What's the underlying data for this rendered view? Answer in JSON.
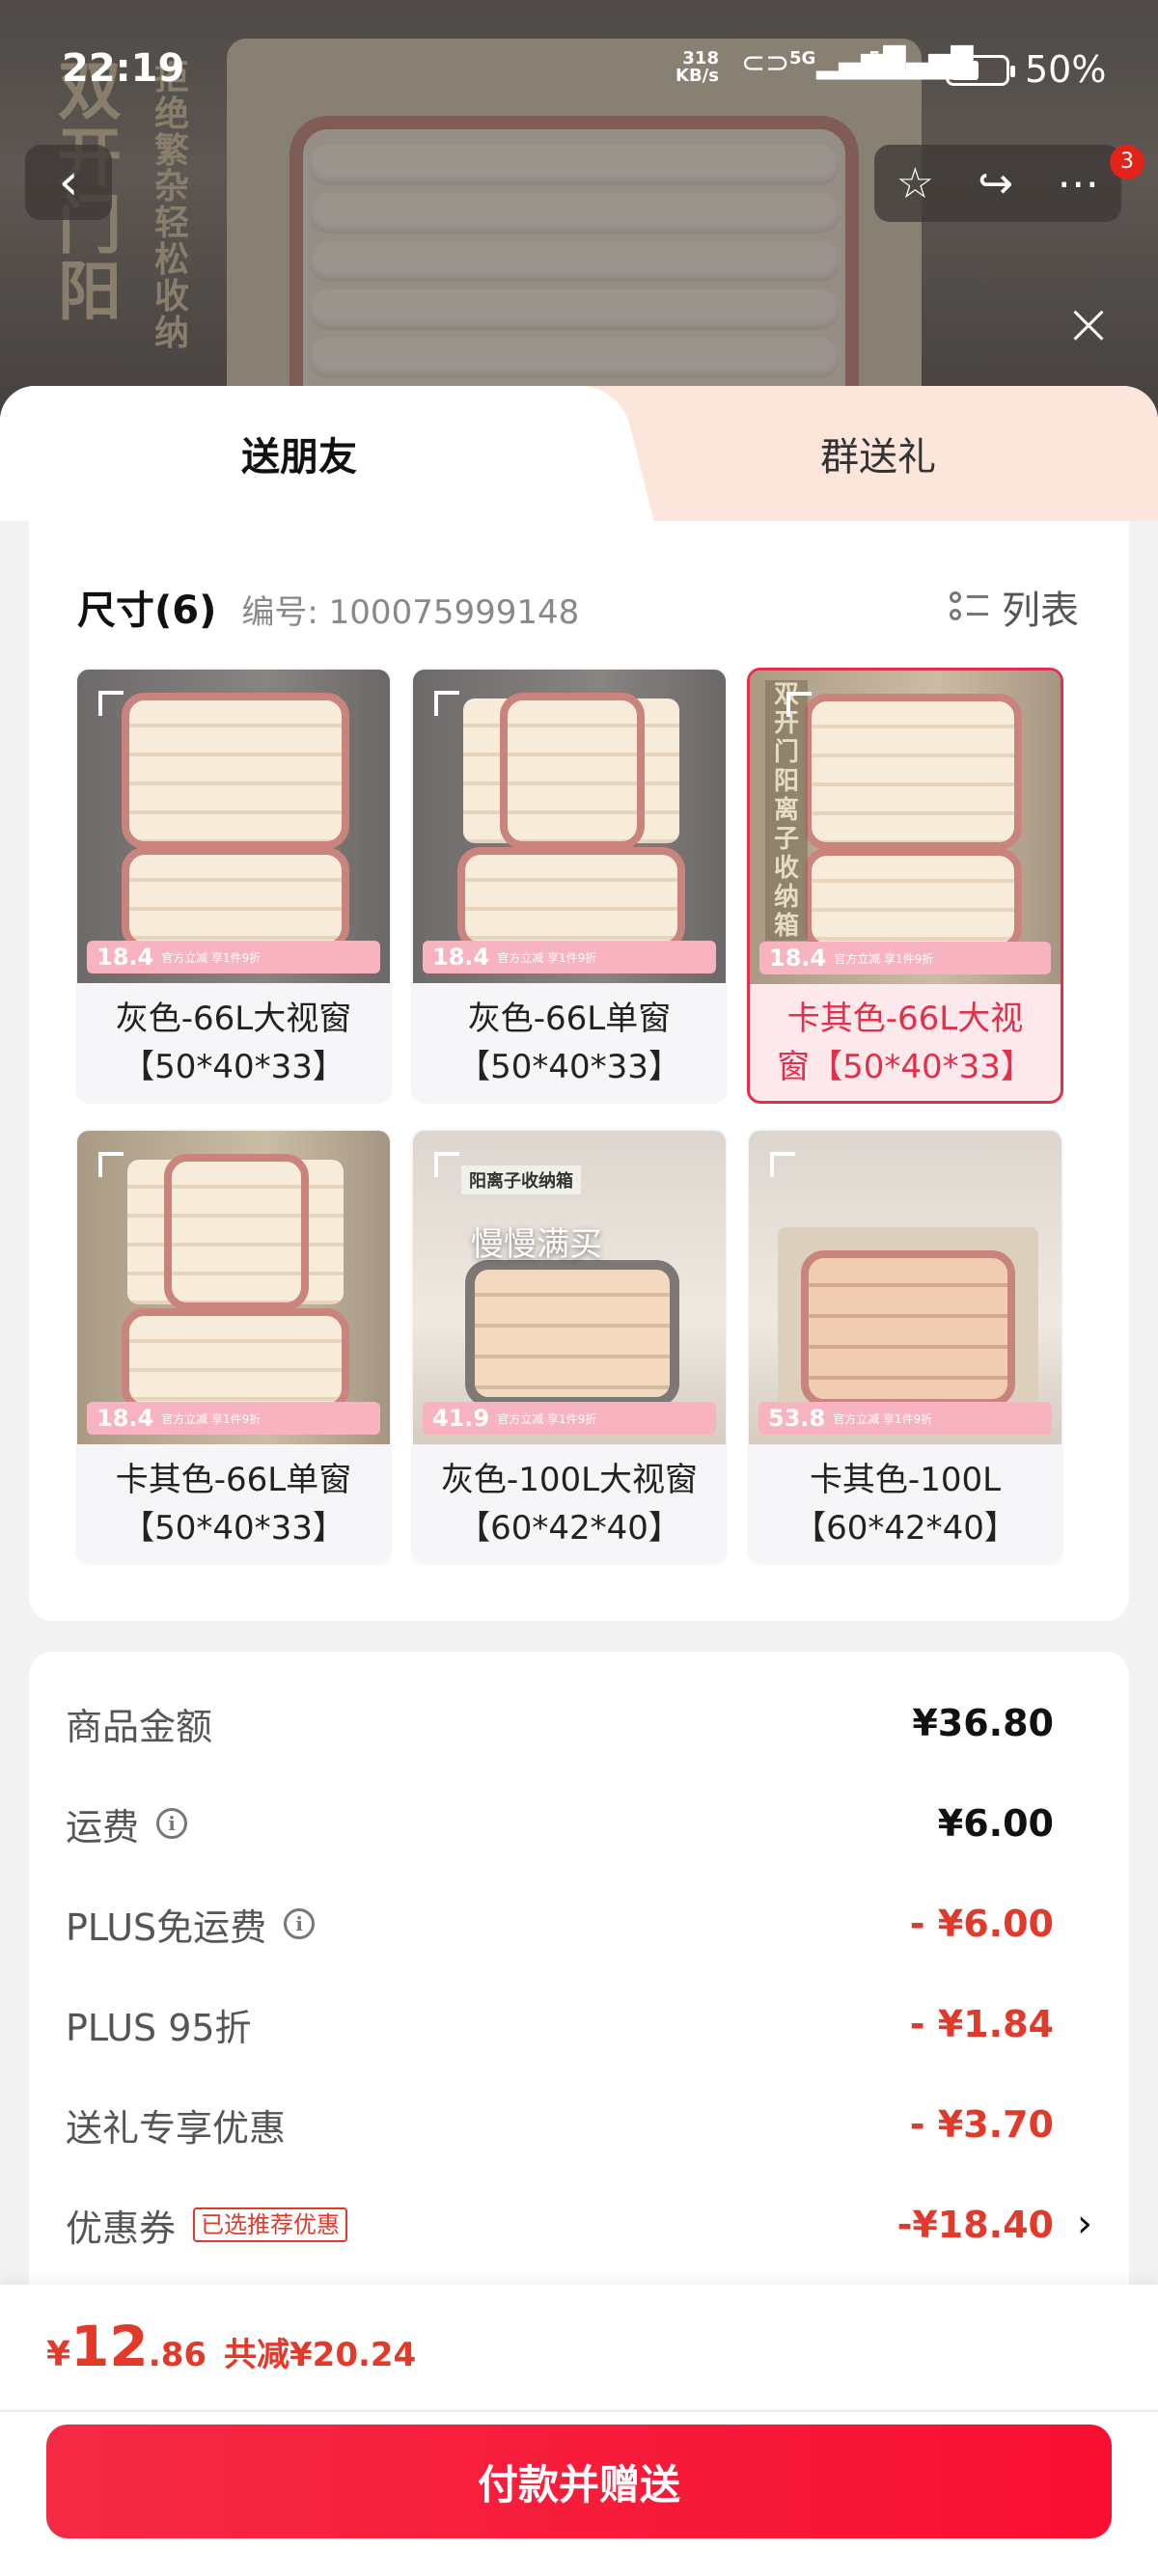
{
  "status_bar": {
    "time": "22:19",
    "net_speed_value": "318",
    "net_speed_unit": "KB/s",
    "signal1": "5G",
    "signal2": "5G",
    "battery": "50%"
  },
  "header": {
    "back_icon": "chevron-left-icon",
    "star_icon": "star-icon",
    "share_icon": "share-icon",
    "more_icon": "more-icon",
    "badge_count": "3",
    "close_icon": "close-icon",
    "photo_text_big": "双开门阳",
    "photo_text_small": "拒绝繁杂 轻松收纳"
  },
  "tabs": {
    "friend": "送朋友",
    "group": "群送礼"
  },
  "size_section": {
    "title": "尺寸(6)",
    "code": "编号: 100075999148",
    "list_label": "列表"
  },
  "options": [
    {
      "line1": "灰色-66L大视窗",
      "line2": "【50*40*33】",
      "price": "18.4",
      "promo": "官方立减 享1件9折",
      "selected": false
    },
    {
      "line1": "灰色-66L单窗",
      "line2": "【50*40*33】",
      "price": "18.4",
      "promo": "官方立减 享1件9折",
      "selected": false
    },
    {
      "line1": "卡其色-66L大视",
      "line2": "窗【50*40*33】",
      "price": "18.4",
      "promo": "官方立减 享1件9折",
      "selected": true,
      "overlay": "双开门阳离子收纳箱"
    },
    {
      "line1": "卡其色-66L单窗",
      "line2": "【50*40*33】",
      "price": "18.4",
      "promo": "官方立减 享1件9折",
      "selected": false
    },
    {
      "line1": "灰色-100L大视窗",
      "line2": "【60*42*40】",
      "price": "41.9",
      "promo": "官方立减 享1件9折",
      "selected": false,
      "overlay": "慢慢满买",
      "tag": "阳离子收纳箱"
    },
    {
      "line1": "卡其色-100L",
      "line2": "【60*42*40】",
      "price": "53.8",
      "promo": "官方立减 享1件9折",
      "selected": false
    }
  ],
  "price_rows": {
    "goods": {
      "label": "商品金额",
      "value": "¥36.80"
    },
    "shipping": {
      "label": "运费",
      "value": "¥6.00"
    },
    "plus_free": {
      "label": "PLUS免运费",
      "value": "- ¥6.00"
    },
    "plus_discount": {
      "label": "PLUS 95折",
      "value": "- ¥1.84"
    },
    "gift_discount": {
      "label": "送礼专享优惠",
      "value": "- ¥3.70"
    },
    "coupon": {
      "label": "优惠券",
      "tag": "已选推荐优惠",
      "value": "-¥18.40"
    }
  },
  "bottom_bar": {
    "currency": "¥",
    "total_int": "12",
    "total_dec": ".86",
    "saved": "共减¥20.24",
    "pay_button": "付款并赠送"
  },
  "colors": {
    "accent_red": "#e23a2a",
    "button_red": "#f42a44",
    "selected_border": "#e0304a",
    "tab_bg": "#fce6dc"
  }
}
